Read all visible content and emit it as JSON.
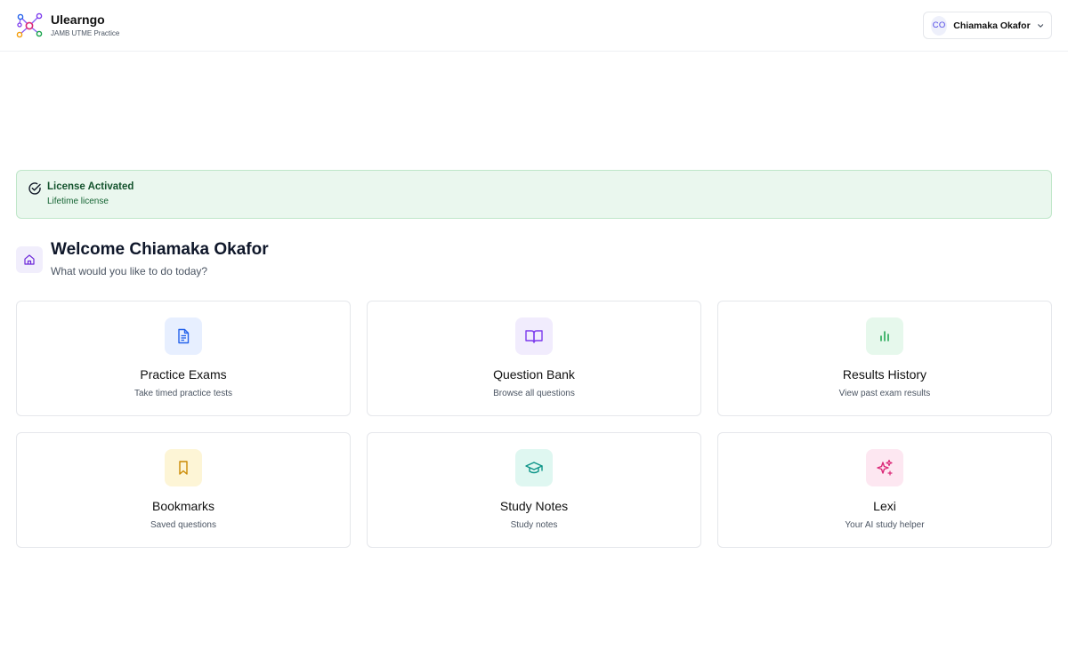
{
  "header": {
    "app_name": "Ulearngo",
    "app_subtitle": "JAMB UTME Practice",
    "user": {
      "initials": "CO",
      "name": "Chiamaka Okafor"
    }
  },
  "license": {
    "title": "License Activated",
    "subtitle": "Lifetime license"
  },
  "welcome": {
    "title": "Welcome Chiamaka Okafor",
    "subtitle": "What would you like to do today?"
  },
  "cards": [
    {
      "title": "Practice Exams",
      "subtitle": "Take timed practice tests",
      "icon": "document-icon",
      "accent": "#2563eb",
      "bg": "#e7efff"
    },
    {
      "title": "Question Bank",
      "subtitle": "Browse all questions",
      "icon": "book-open-icon",
      "accent": "#7c3aed",
      "bg": "#f1ecfd"
    },
    {
      "title": "Results History",
      "subtitle": "View past exam results",
      "icon": "bar-chart-icon",
      "accent": "#16a34a",
      "bg": "#e6f8ec"
    },
    {
      "title": "Bookmarks",
      "subtitle": "Saved questions",
      "icon": "bookmark-icon",
      "accent": "#ca8a04",
      "bg": "#fdf5d6"
    },
    {
      "title": "Study Notes",
      "subtitle": "Study notes",
      "icon": "graduation-cap-icon",
      "accent": "#0d9488",
      "bg": "#dff7f1"
    },
    {
      "title": "Lexi",
      "subtitle": "Your AI study helper",
      "icon": "sparkles-icon",
      "accent": "#db2777",
      "bg": "#fde7f1"
    }
  ]
}
